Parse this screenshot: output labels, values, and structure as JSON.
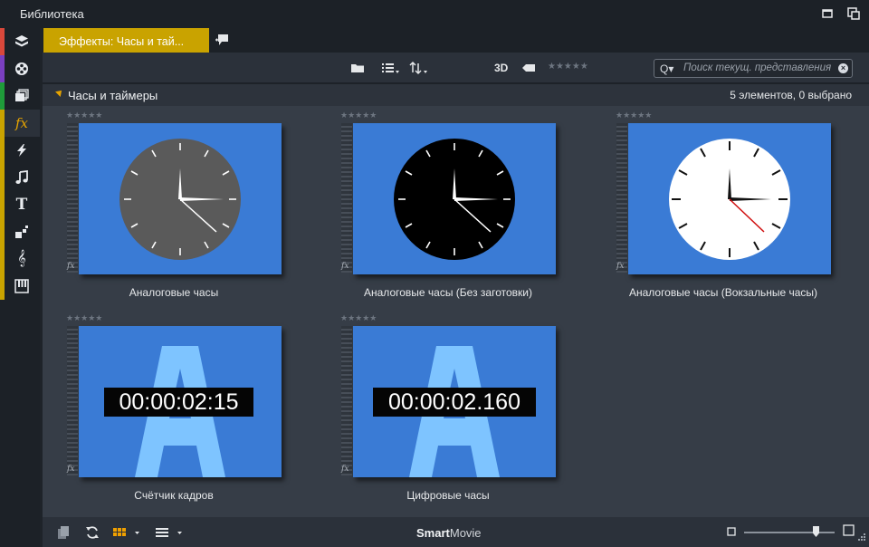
{
  "window": {
    "title": "Библиотека"
  },
  "tabs": [
    {
      "label": "Эффекты: Часы и тай..."
    }
  ],
  "toolbar": {
    "view_3d": "3D"
  },
  "search": {
    "placeholder": "Поиск текущ. представления"
  },
  "group": {
    "name": "Часы и таймеры",
    "count_text": "5 элементов, 0 выбрано"
  },
  "items": [
    {
      "caption": "Аналоговые часы",
      "stars": "★★★★★",
      "kind": "analog",
      "face": "#5a5a5a"
    },
    {
      "caption": "Аналоговые часы (Без заготовки)",
      "stars": "★★★★★",
      "kind": "analog",
      "face": "#000000"
    },
    {
      "caption": "Аналоговые часы (Вокзальные часы)",
      "stars": "★★★★★",
      "kind": "analog-white",
      "face": "#ffffff"
    },
    {
      "caption": "Счётчик кадров",
      "stars": "★★★★★",
      "kind": "digital",
      "readout": "00:00:02:15"
    },
    {
      "caption": "Цифровые часы",
      "stars": "★★★★★",
      "kind": "digital",
      "readout": "00:00:02.160"
    }
  ],
  "bottombar": {
    "brand_bold": "Smart",
    "brand_rest": "Movie"
  },
  "sidebar": {
    "icons": [
      "projects-icon",
      "film-reel-icon",
      "media-icon",
      "fx-icon",
      "transitions-icon",
      "music-icon",
      "text-icon",
      "montage-icon",
      "score-icon",
      "piano-icon"
    ],
    "colors": [
      "#d9483b",
      "#7a3fc0",
      "#7a3fc0",
      "#1f9b3a",
      "#c9a300",
      "#c9a300",
      "#c9a300",
      "#c9a300",
      "#c9a300",
      "#c9a300"
    ]
  },
  "colors": {
    "accent": "#c9a300",
    "thumb_bg": "#3a7bd5"
  }
}
